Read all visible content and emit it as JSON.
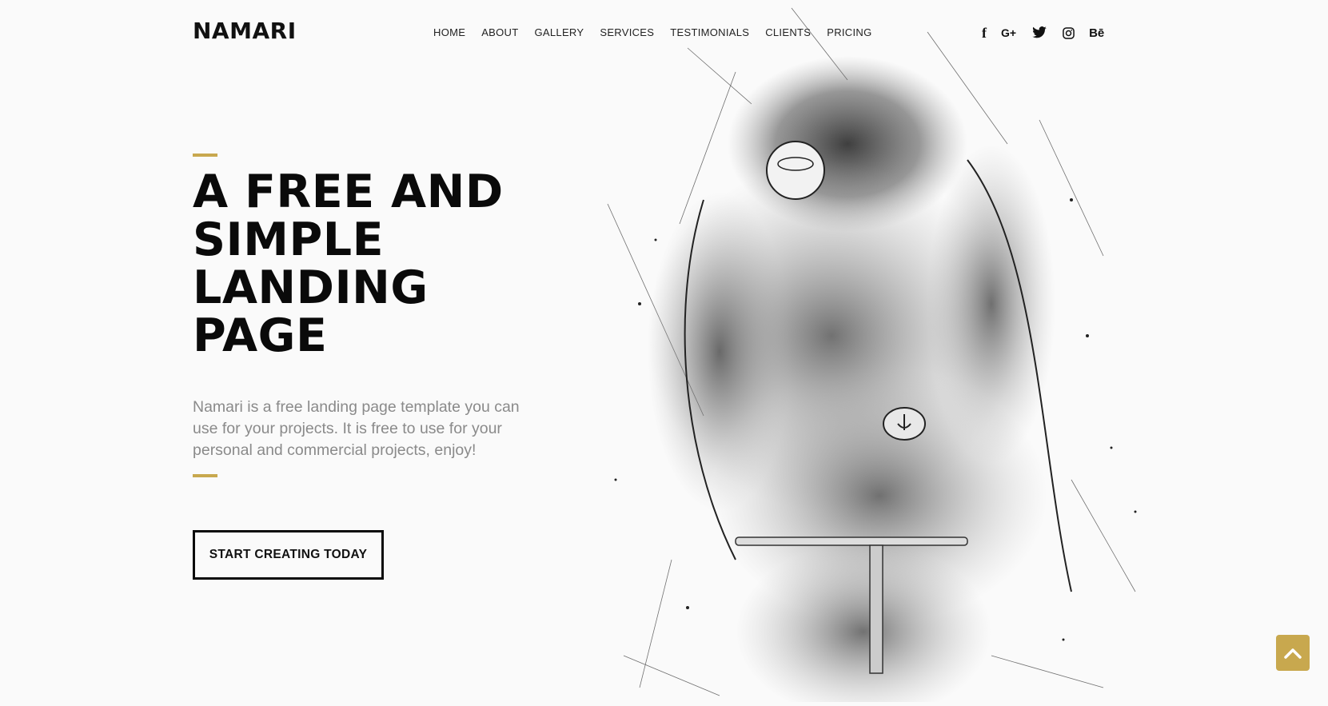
{
  "brand": {
    "logo_text": "NAMARI"
  },
  "nav": {
    "items": [
      {
        "label": "HOME"
      },
      {
        "label": "ABOUT"
      },
      {
        "label": "GALLERY"
      },
      {
        "label": "SERVICES"
      },
      {
        "label": "TESTIMONIALS"
      },
      {
        "label": "CLIENTS"
      },
      {
        "label": "PRICING"
      }
    ]
  },
  "social": {
    "items": [
      {
        "icon": "facebook-icon",
        "glyph": "f"
      },
      {
        "icon": "google-plus-icon",
        "glyph": "G+"
      },
      {
        "icon": "twitter-icon",
        "glyph": ""
      },
      {
        "icon": "instagram-icon",
        "glyph": ""
      },
      {
        "icon": "behance-icon",
        "glyph": "Bē"
      }
    ]
  },
  "hero": {
    "title_lines": [
      "A FREE AND",
      "SIMPLE",
      "LANDING",
      "PAGE"
    ],
    "description": "Namari is a free landing page template you can use for your projects. It is free to use for your personal and commercial projects, enjoy!",
    "cta_label": "START CREATING TODAY"
  },
  "colors": {
    "accent": "#c8a84e",
    "text": "#0a0a0a",
    "muted": "#8a8a8a",
    "background": "#fafafa"
  },
  "scroll_top": {
    "icon": "chevron-up-icon"
  }
}
